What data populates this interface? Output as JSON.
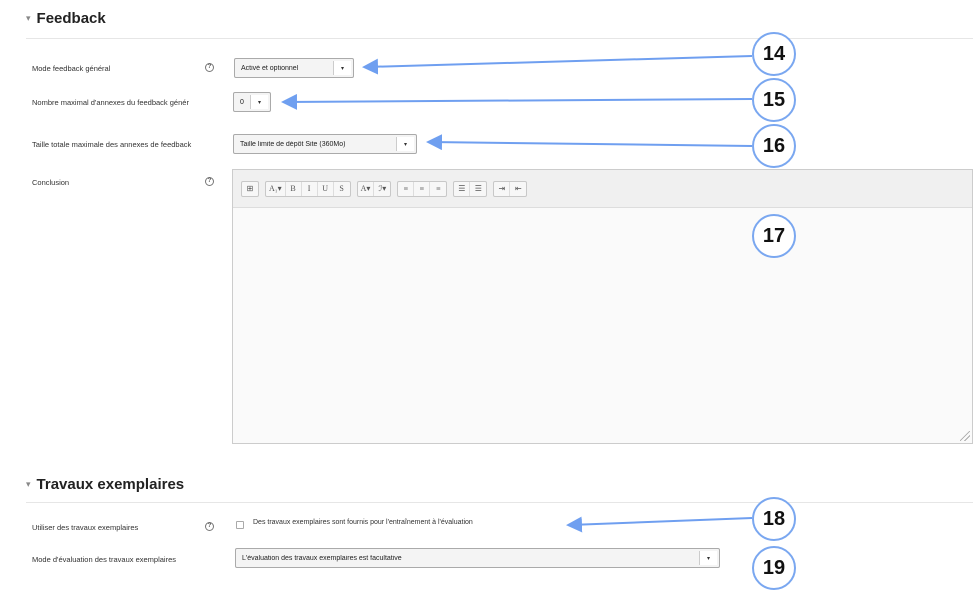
{
  "feedback": {
    "section_title": "Feedback",
    "mode_label": "Mode feedback général",
    "mode_value": "Activé et optionnel",
    "max_annexes_label": "Nombre maximal d'annexes du feedback génér",
    "max_annexes_value": "0",
    "max_size_label": "Taille totale maximale des annexes de feedback",
    "max_size_value": "Taille limite de dépôt Site (360Mo)",
    "conclusion_label": "Conclusion"
  },
  "toolbar": {
    "groups": [
      [
        "⊞"
      ],
      [
        "A₁▾",
        "B",
        "I",
        "U",
        "S"
      ],
      [
        "A▾",
        "ℐ▾"
      ],
      [
        "≡",
        "≡",
        "≡"
      ],
      [
        "☰",
        "☰"
      ],
      [
        "⇥",
        "⇤"
      ]
    ]
  },
  "exemplaires": {
    "section_title": "Travaux exemplaires",
    "use_label": "Utiliser des travaux exemplaires",
    "use_checkbox_text": "Des travaux exemplaires sont fournis pour l'entraînement à l'évaluation",
    "eval_mode_label": "Mode d'évaluation des travaux exemplaires",
    "eval_mode_value": "L'évaluation des travaux exemplaires est facultative"
  },
  "callouts": [
    "14",
    "15",
    "16",
    "17",
    "18",
    "19"
  ],
  "colors": {
    "callout_border": "#7aa7f0",
    "arrow": "#6f9ff0"
  }
}
